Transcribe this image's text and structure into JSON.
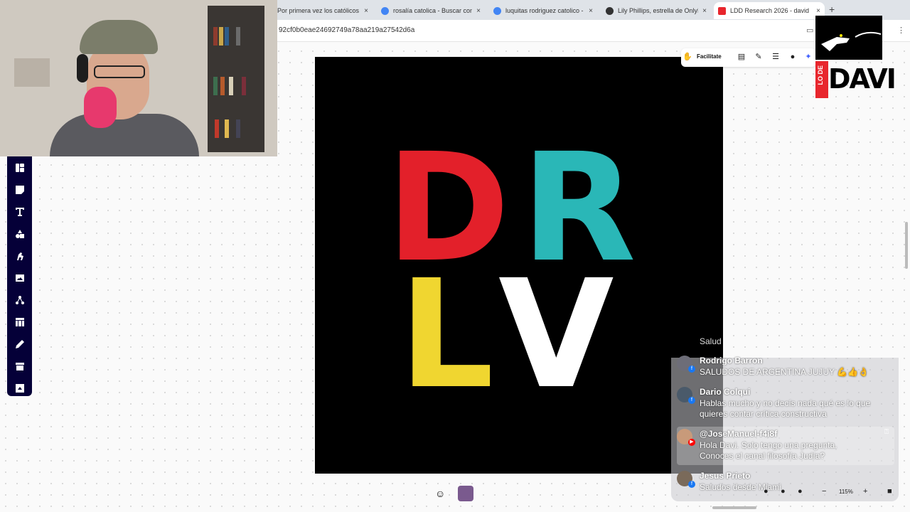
{
  "browser": {
    "tabs": [
      {
        "label": "Por primera vez los católicos",
        "active": false,
        "favicon_color": "#c0392b"
      },
      {
        "label": "rosalía catolica - Buscar con",
        "active": false,
        "favicon_color": "#4285f4"
      },
      {
        "label": "luquitas rodriguez catolico -",
        "active": false,
        "favicon_color": "#4285f4"
      },
      {
        "label": "Lily Phillips, estrella de OnlyF",
        "active": false,
        "favicon_color": "#333333"
      },
      {
        "label": "LDD Research 2026 - david",
        "active": true,
        "favicon_color": "#e8262d"
      }
    ],
    "new_tab_symbol": "+",
    "close_symbol": "×",
    "url": "92cf0b0eae24692749a78aa219a27542d6a"
  },
  "board_toolbar": {
    "facilitate_label": "Facilitate",
    "icons": [
      "layout-icon",
      "comments-icon",
      "chat-icon",
      "user-icon",
      "sparkle-icon"
    ]
  },
  "left_toolbar": {
    "tools": [
      "templates-icon",
      "sticky-note-icon",
      "text-icon",
      "shapes-icon",
      "emoji-icon",
      "image-icon",
      "diagram-icon",
      "table-icon",
      "pen-icon",
      "frame-icon",
      "upload-icon"
    ]
  },
  "board_image": {
    "letters": [
      {
        "char": "D",
        "color": "#e3202a"
      },
      {
        "char": "R",
        "color": "#2ab7b7"
      },
      {
        "char": "L",
        "color": "#f0d630"
      },
      {
        "char": "V",
        "color": "#ffffff"
      }
    ]
  },
  "logo": {
    "small_text": "LO DE",
    "big_text": "DAVI"
  },
  "chat": {
    "partial_top_text": "Salud",
    "messages": [
      {
        "author": "Rodrigo Barron",
        "text": "SALUDOS DE ARGENTINA JUJUY 💪👍👌",
        "platform": "facebook",
        "highlight": false
      },
      {
        "author": "Dario Colqui",
        "text": "Hablas mucho y no decís nada qué es lo que quieres contar crítica constructiva",
        "platform": "facebook",
        "highlight": false
      },
      {
        "author": "@JoseManuel-f4i8f",
        "text": "Hola Davi. Solo tengo una pregunta. Conoces el canal filosofía Judía?",
        "platform": "youtube",
        "highlight": true
      },
      {
        "author": "Jesus Prieto",
        "text": "Saludos desde Miami",
        "platform": "facebook",
        "highlight": false
      }
    ]
  },
  "zoom": {
    "minus": "−",
    "level": "115%",
    "plus": "+"
  },
  "colors": {
    "toolbar_bg": "#050038",
    "board_bg": "#fafafa"
  }
}
